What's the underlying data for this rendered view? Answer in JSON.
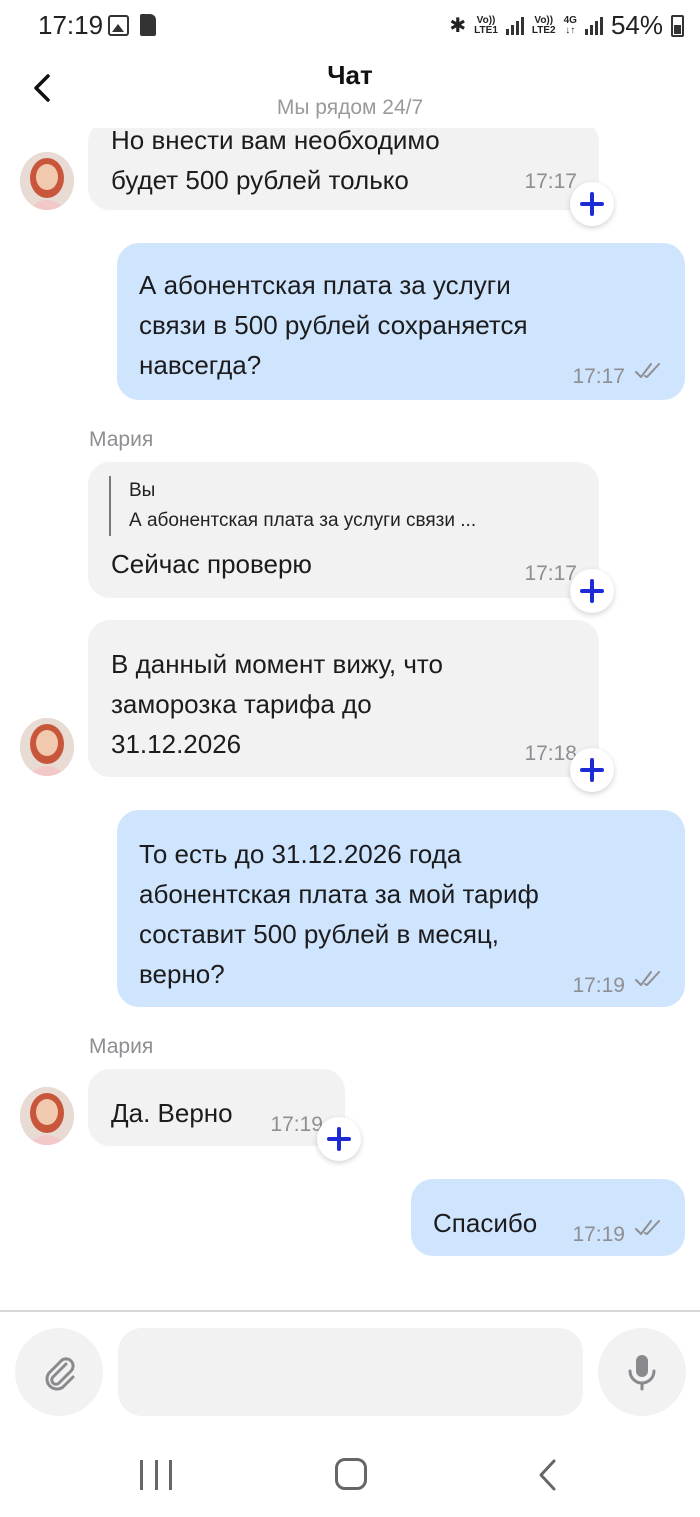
{
  "status_bar": {
    "time": "17:19",
    "sim1": "LTE1",
    "sim2": "LTE2",
    "net_label": "4G",
    "battery": "54%",
    "icons": [
      "gallery-icon",
      "sd-card-icon",
      "bluetooth-icon",
      "signal-icon",
      "battery-icon"
    ]
  },
  "header": {
    "title": "Чат",
    "subtitle": "Мы рядом 24/7",
    "back_icon": "chevron-left-icon"
  },
  "colors": {
    "incoming_bubble": "#f2f2f3",
    "outgoing_bubble": "#cfe5fd",
    "plus_accent": "#1d2bd6",
    "muted_text": "#8e8e93"
  },
  "messages": [
    {
      "direction": "in",
      "text": "Но внести вам необходимо\nбудет 500 рублей только",
      "time": "17:17"
    },
    {
      "direction": "out",
      "text": "А абонентская плата за услуги\nсвязи в 500 рублей сохраняется\nнавсегда?",
      "time": "17:17"
    },
    {
      "direction": "in",
      "sender": "Мария",
      "quote_author": "Вы",
      "quote_text": "А абонентская плата за услуги связи ...",
      "text": "Сейчас проверю",
      "time": "17:17"
    },
    {
      "direction": "in",
      "text": "В данный момент вижу, что\nзаморозка тарифа до\n31.12.2026",
      "time": "17:18"
    },
    {
      "direction": "out",
      "text": "То есть до 31.12.2026 года\nабонентская плата за мой тариф\nсоставит 500 рублей в месяц,\nверно?",
      "time": "17:19"
    },
    {
      "direction": "in",
      "sender": "Мария",
      "text": "Да. Верно",
      "time": "17:19"
    },
    {
      "direction": "out",
      "text": "Спасибо",
      "time": "17:19"
    }
  ],
  "composer": {
    "placeholder": "",
    "attach_icon": "paperclip-icon",
    "mic_icon": "microphone-icon"
  },
  "navbar": {
    "icons": [
      "recent-apps-icon",
      "home-icon",
      "back-icon"
    ]
  }
}
